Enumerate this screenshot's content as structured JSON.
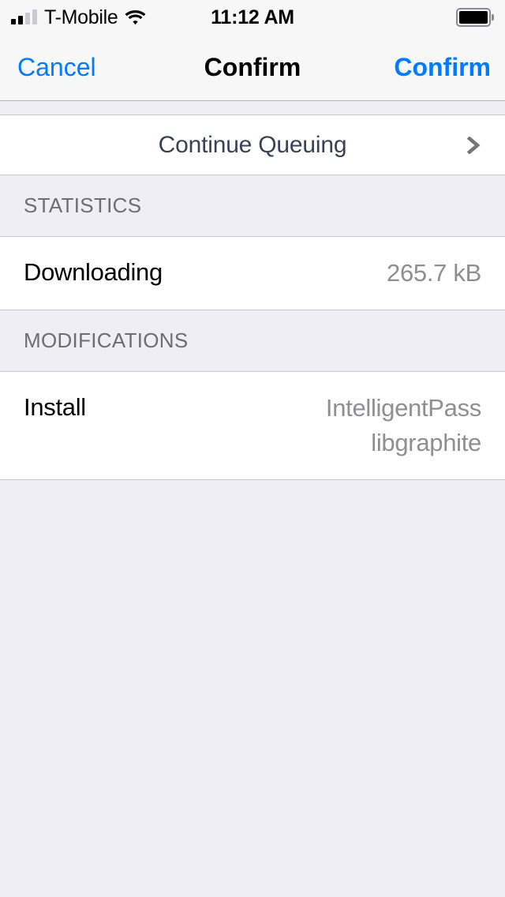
{
  "status_bar": {
    "carrier": "T-Mobile",
    "time": "11:12 AM",
    "signal_bars_filled": 2,
    "signal_bars_total": 4,
    "wifi_icon": "wifi-icon",
    "battery_icon": "battery-full-icon"
  },
  "nav_bar": {
    "cancel_label": "Cancel",
    "title": "Confirm",
    "confirm_label": "Confirm",
    "accent_color": "#007aff"
  },
  "content": {
    "queue_row": {
      "label": "Continue Queuing",
      "chevron_icon": "chevron-right-icon",
      "label_color": "#3a4155"
    },
    "sections": [
      {
        "header": "STATISTICS",
        "rows": [
          {
            "key": "Downloading",
            "values": [
              "265.7 kB"
            ]
          }
        ]
      },
      {
        "header": "MODIFICATIONS",
        "rows": [
          {
            "key": "Install",
            "values": [
              "IntelligentPass",
              "libgraphite"
            ]
          }
        ]
      }
    ]
  },
  "colors": {
    "background": "#efeef4",
    "row_background": "#ffffff",
    "separator": "#c8c7cc",
    "secondary_text": "#8e8e93",
    "header_text": "#6d6d72"
  }
}
